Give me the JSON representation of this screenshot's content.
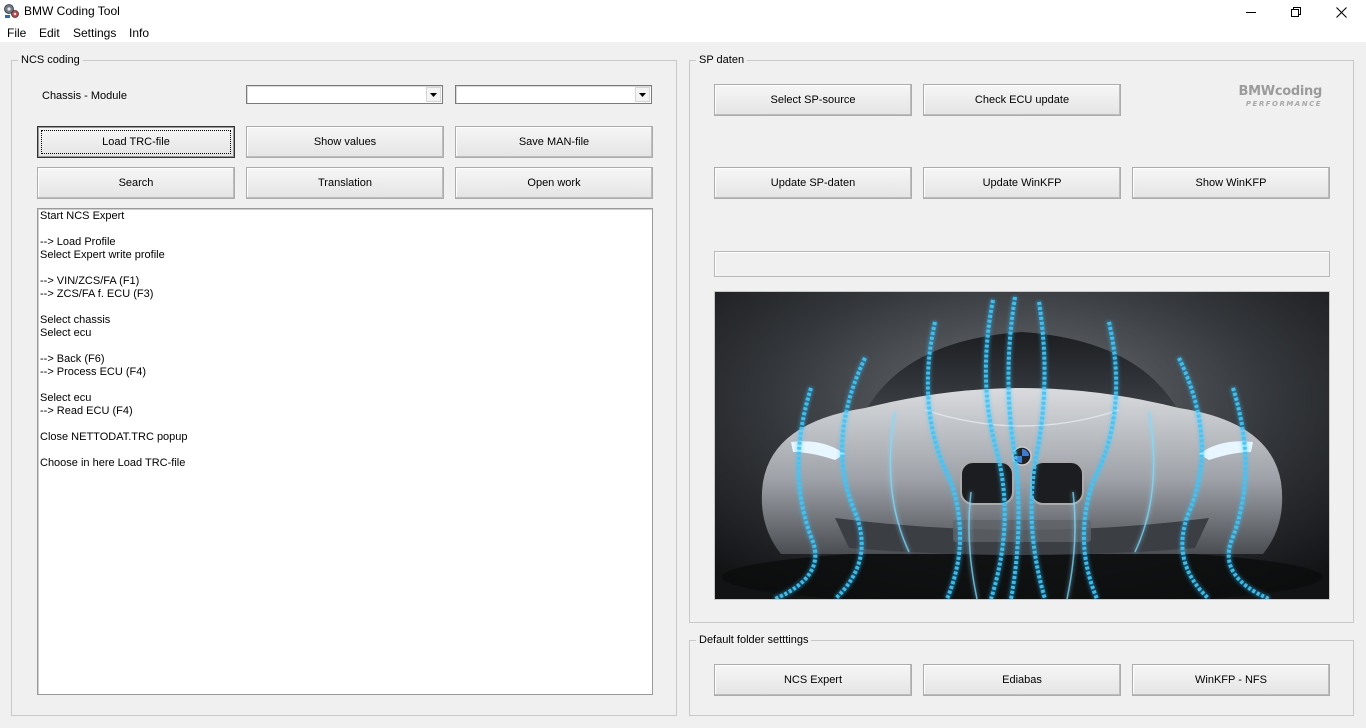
{
  "window": {
    "title": "BMW Coding Tool",
    "icon": "bmw-tool-icon"
  },
  "menu": {
    "items": [
      "File",
      "Edit",
      "Settings",
      "Info"
    ]
  },
  "ncs": {
    "group_title": "NCS coding",
    "chassis_label": "Chassis - Module",
    "chassis_value": "",
    "module_value": "",
    "buttons": {
      "load_trc": "Load TRC-file",
      "show_values": "Show values",
      "save_man": "Save MAN-file",
      "search": "Search",
      "translation": "Translation",
      "open_work": "Open work"
    },
    "log_text": "Start NCS Expert\n\n--> Load Profile\nSelect Expert write profile\n\n--> VIN/ZCS/FA (F1)\n--> ZCS/FA f. ECU (F3)\n\nSelect chassis\nSelect ecu\n\n--> Back (F6)\n--> Process ECU (F4)\n\nSelect ecu\n--> Read ECU (F4)\n\nClose NETTODAT.TRC popup\n\nChoose in here Load TRC-file"
  },
  "sp": {
    "group_title": "SP daten",
    "buttons": {
      "select_source": "Select SP-source",
      "check_ecu": "Check ECU update",
      "update_sp": "Update SP-daten",
      "update_winkfp": "Update WinKFP",
      "show_winkfp": "Show WinKFP"
    },
    "logo_main": "BMWcoding",
    "logo_sub": "PERFORMANCE",
    "progress": 0
  },
  "folders": {
    "group_title": "Default folder setttings",
    "buttons": {
      "ncs_expert": "NCS Expert",
      "ediabas": "Ediabas",
      "winkfp_nfs": "WinKFP - NFS"
    }
  },
  "colors": {
    "window_bg": "#f0f0f0",
    "light_trail": "#39c8ff"
  }
}
